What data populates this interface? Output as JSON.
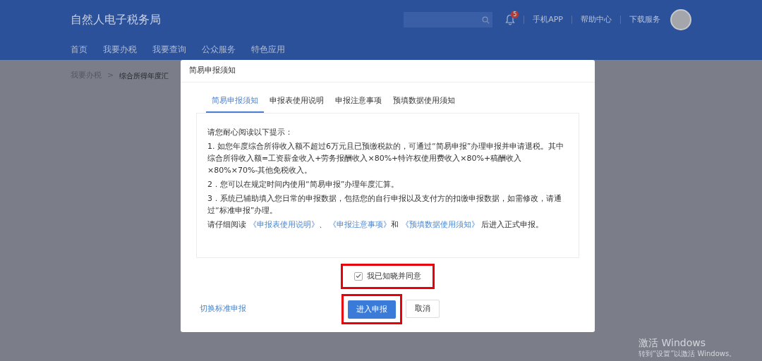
{
  "header": {
    "title": "自然人电子税务局",
    "notifications": {
      "badge": "5"
    },
    "links": [
      "手机APP",
      "帮助中心",
      "下载服务"
    ]
  },
  "nav": [
    {
      "label": "首页"
    },
    {
      "label": "我要办税"
    },
    {
      "label": "我要查询"
    },
    {
      "label": "公众服务"
    },
    {
      "label": "特色应用"
    }
  ],
  "breadcrumb": [
    "我要办税",
    "综合所得年度汇"
  ],
  "breadcrumb_separator": ">",
  "dialog": {
    "title": "简易申报须知",
    "tabs": [
      {
        "label": "简易申报须知",
        "selected": true
      },
      {
        "label": "申报表使用说明",
        "selected": false
      },
      {
        "label": "申报注意事项",
        "selected": false
      },
      {
        "label": "预填数据使用须知",
        "selected": false
      }
    ],
    "intro": "请您耐心阅读以下提示：",
    "items": [
      "1. 如您年度综合所得收入额不超过6万元且已预缴税款的，可通过“简易申报”办理申报并申请退税。其中综合所得收入额=工资薪金收入+劳务报酬收入×80%+特许权使用费收入×80%+稿酬收入×80%×70%-其他免税收入。",
      "2．您可以在规定时间内使用“简易申报”办理年度汇算。",
      "3．系统已辅助填入您日常的申报数据，包括您的自行申报以及支付方的扣缴申报数据，如需修改，请通过“标准申报”办理。"
    ],
    "reading": [
      {
        "kind": "text",
        "text": "请仔细阅读 "
      },
      {
        "kind": "link",
        "text": "《申报表使用说明》"
      },
      {
        "kind": "text",
        "text": "、 "
      },
      {
        "kind": "link",
        "text": "《申报注意事项》"
      },
      {
        "kind": "text",
        "text": "和 "
      },
      {
        "kind": "link",
        "text": "《预填数据使用须知》"
      },
      {
        "kind": "text",
        "text": " 后进入正式申报。"
      }
    ],
    "agree": {
      "label": "我已知晓并同意",
      "checked": true,
      "highlighted": true
    },
    "switch_link": "切换标准申报",
    "buttons": [
      {
        "label": "进入申报",
        "kind": "primary",
        "highlighted": true
      },
      {
        "label": "取消",
        "kind": "secondary",
        "highlighted": false
      }
    ]
  },
  "activation": {
    "title": "激活 Windows",
    "subtitle": "转到“设置”以激活 Windows。"
  }
}
